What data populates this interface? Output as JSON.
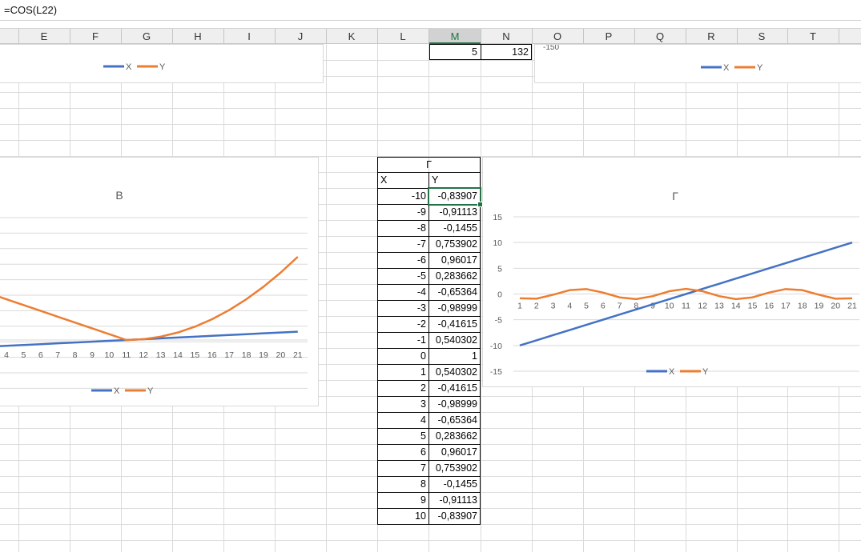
{
  "formula_bar": {
    "text": "=COS(L22)"
  },
  "columns": [
    "E",
    "F",
    "G",
    "H",
    "I",
    "J",
    "K",
    "L",
    "M",
    "N",
    "O",
    "P",
    "Q",
    "R",
    "S",
    "T"
  ],
  "active_column": "M",
  "top_cells": {
    "m_value": "5",
    "n_value": "132"
  },
  "table": {
    "title": "Г",
    "header_x": "X",
    "header_y": "Y",
    "rows": [
      {
        "x": "-10",
        "y": "-0,83907"
      },
      {
        "x": "-9",
        "y": "-0,91113"
      },
      {
        "x": "-8",
        "y": "-0,1455"
      },
      {
        "x": "-7",
        "y": "0,753902"
      },
      {
        "x": "-6",
        "y": "0,96017"
      },
      {
        "x": "-5",
        "y": "0,283662"
      },
      {
        "x": "-4",
        "y": "-0,65364"
      },
      {
        "x": "-3",
        "y": "-0,98999"
      },
      {
        "x": "-2",
        "y": "-0,41615"
      },
      {
        "x": "-1",
        "y": "0,540302"
      },
      {
        "x": "0",
        "y": "1"
      },
      {
        "x": "1",
        "y": "0,540302"
      },
      {
        "x": "2",
        "y": "-0,41615"
      },
      {
        "x": "3",
        "y": "-0,98999"
      },
      {
        "x": "4",
        "y": "-0,65364"
      },
      {
        "x": "5",
        "y": "0,283662"
      },
      {
        "x": "6",
        "y": "0,96017"
      },
      {
        "x": "7",
        "y": "0,753902"
      },
      {
        "x": "8",
        "y": "-0,1455"
      },
      {
        "x": "9",
        "y": "-0,91113"
      },
      {
        "x": "10",
        "y": "-0,83907"
      }
    ]
  },
  "colors": {
    "series_x": "#4472c4",
    "series_y": "#ed7d31",
    "accent": "#217346"
  },
  "charts": {
    "top_left": {
      "legend": [
        "X",
        "Y"
      ]
    },
    "top_right": {
      "legend": [
        "X",
        "Y"
      ],
      "partial_tick": "-150"
    },
    "chart_b": {
      "title": "В",
      "legend": [
        "X",
        "Y"
      ],
      "x_ticks": [
        "4",
        "5",
        "6",
        "7",
        "8",
        "9",
        "10",
        "11",
        "12",
        "13",
        "14",
        "15",
        "16",
        "17",
        "18",
        "19",
        "20",
        "21"
      ]
    },
    "chart_g": {
      "title": "Г",
      "legend": [
        "X",
        "Y"
      ],
      "y_ticks": [
        "15",
        "10",
        "5",
        "0",
        "-5",
        "-10",
        "-15"
      ],
      "x_ticks": [
        "1",
        "2",
        "3",
        "4",
        "5",
        "6",
        "7",
        "8",
        "9",
        "10",
        "11",
        "12",
        "13",
        "14",
        "15",
        "16",
        "17",
        "18",
        "19",
        "20",
        "21"
      ]
    }
  },
  "chart_data": [
    {
      "type": "line",
      "title": "В",
      "categories": [
        "4",
        "5",
        "6",
        "7",
        "8",
        "9",
        "10",
        "11",
        "12",
        "13",
        "14",
        "15",
        "16",
        "17",
        "18",
        "19",
        "20",
        "21"
      ],
      "series": [
        {
          "name": "X",
          "values": [
            -7,
            -6,
            -5,
            -4,
            -3,
            -2,
            -1,
            0,
            1,
            2,
            3,
            4,
            5,
            6,
            7,
            8,
            9,
            10
          ]
        },
        {
          "name": "Y",
          "values": [
            49,
            42,
            35,
            28,
            21,
            14,
            7,
            0,
            1,
            4,
            9,
            16,
            25,
            36,
            49,
            64,
            81,
            100
          ]
        }
      ]
    },
    {
      "type": "line",
      "title": "Г",
      "categories": [
        "1",
        "2",
        "3",
        "4",
        "5",
        "6",
        "7",
        "8",
        "9",
        "10",
        "11",
        "12",
        "13",
        "14",
        "15",
        "16",
        "17",
        "18",
        "19",
        "20",
        "21"
      ],
      "ylim": [
        -15,
        15
      ],
      "series": [
        {
          "name": "X",
          "values": [
            -10,
            -9,
            -8,
            -7,
            -6,
            -5,
            -4,
            -3,
            -2,
            -1,
            0,
            1,
            2,
            3,
            4,
            5,
            6,
            7,
            8,
            9,
            10
          ]
        },
        {
          "name": "Y",
          "values": [
            -0.83907,
            -0.91113,
            -0.1455,
            0.753902,
            0.96017,
            0.283662,
            -0.65364,
            -0.98999,
            -0.41615,
            0.540302,
            1,
            0.540302,
            -0.41615,
            -0.98999,
            -0.65364,
            0.283662,
            0.96017,
            0.753902,
            -0.1455,
            -0.91113,
            -0.83907
          ]
        }
      ]
    }
  ]
}
